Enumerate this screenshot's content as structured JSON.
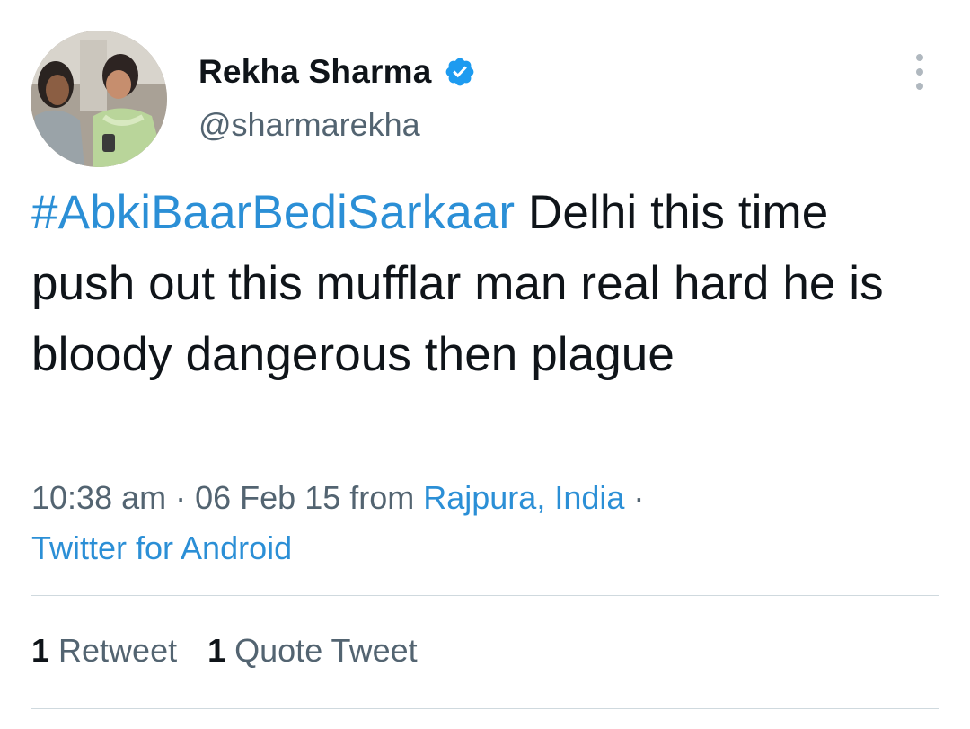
{
  "author": {
    "display_name": "Rekha Sharma",
    "handle": "@sharmarekha",
    "verified": true,
    "avatar_icon": "profile-photo",
    "verified_icon": "verified-badge-icon",
    "verified_color": "#1d9bf0"
  },
  "more_icon": "more-options-vertical-icon",
  "tweet": {
    "hashtag": "#AbkiBaarBediSarkaar",
    "text": " Delhi this time push out this mufflar man real hard he is bloody dangerous then plague"
  },
  "meta": {
    "time": "10:38 am",
    "separator": " · ",
    "date": "06 Feb 15",
    "from_label": " from ",
    "location": "Rajpura, India",
    "separator2": " ·",
    "source": "Twitter for Android"
  },
  "stats": {
    "retweets_count": "1",
    "retweets_label": "Retweet",
    "quotes_count": "1",
    "quotes_label": "Quote Tweet"
  },
  "colors": {
    "link": "#2b8fd6",
    "text": "#0f1419",
    "secondary": "#536471",
    "divider": "#cfd9de"
  }
}
